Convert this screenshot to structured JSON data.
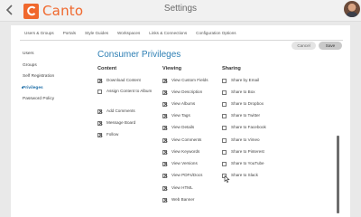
{
  "app": {
    "title": "Settings",
    "logo_text": "Canto",
    "brand_color": "#f0682d",
    "accent_color": "#2e7fb4",
    "back_icon": "chevron-left-icon",
    "avatar_icon": "user-avatar"
  },
  "tabs": [
    {
      "label": "Users & Groups",
      "active": true
    },
    {
      "label": "Portals",
      "active": false
    },
    {
      "label": "Style Guides",
      "active": false
    },
    {
      "label": "Workspaces",
      "active": false
    },
    {
      "label": "Links & Connections",
      "active": false
    },
    {
      "label": "Configuration Options",
      "active": false
    }
  ],
  "actions": {
    "cancel_label": "Cancel",
    "save_label": "Save"
  },
  "sidebar": {
    "items": [
      {
        "label": "Users",
        "active": false
      },
      {
        "label": "Groups",
        "active": false
      },
      {
        "label": "Self Registration",
        "active": false
      },
      {
        "label": "Privileges",
        "active": true
      },
      {
        "label": "Password Policy",
        "active": false
      }
    ]
  },
  "main": {
    "heading": "Consumer Privileges",
    "columns": [
      {
        "title": "Content",
        "options": [
          {
            "label": "Download Content",
            "checked": true
          },
          {
            "label": "Assign Content to Album",
            "checked": false
          },
          {
            "label": "Add Comments",
            "checked": true
          },
          {
            "label": "Message Board",
            "checked": true
          },
          {
            "label": "Follow",
            "checked": true
          }
        ]
      },
      {
        "title": "Viewing",
        "options": [
          {
            "label": "View Custom Fields",
            "checked": true
          },
          {
            "label": "View Description",
            "checked": true
          },
          {
            "label": "View Albums",
            "checked": true
          },
          {
            "label": "View Tags",
            "checked": true
          },
          {
            "label": "View Details",
            "checked": true
          },
          {
            "label": "View Comments",
            "checked": true
          },
          {
            "label": "View Keywords",
            "checked": true
          },
          {
            "label": "View Versions",
            "checked": true
          },
          {
            "label": "View PDFs/Docs",
            "checked": true
          },
          {
            "label": "View HTML",
            "checked": true
          },
          {
            "label": "Web Banner",
            "checked": true
          }
        ]
      },
      {
        "title": "Sharing",
        "options": [
          {
            "label": "Share by Email",
            "checked": false
          },
          {
            "label": "Share to Box",
            "checked": false
          },
          {
            "label": "Share to Dropbox",
            "checked": false
          },
          {
            "label": "Share to Twitter",
            "checked": false
          },
          {
            "label": "Share to Facebook",
            "checked": false
          },
          {
            "label": "Share to Vimeo",
            "checked": false
          },
          {
            "label": "Share to Pinterest",
            "checked": false
          },
          {
            "label": "Share to YouTube",
            "checked": false
          },
          {
            "label": "Share to Slack",
            "checked": false
          }
        ]
      }
    ]
  }
}
